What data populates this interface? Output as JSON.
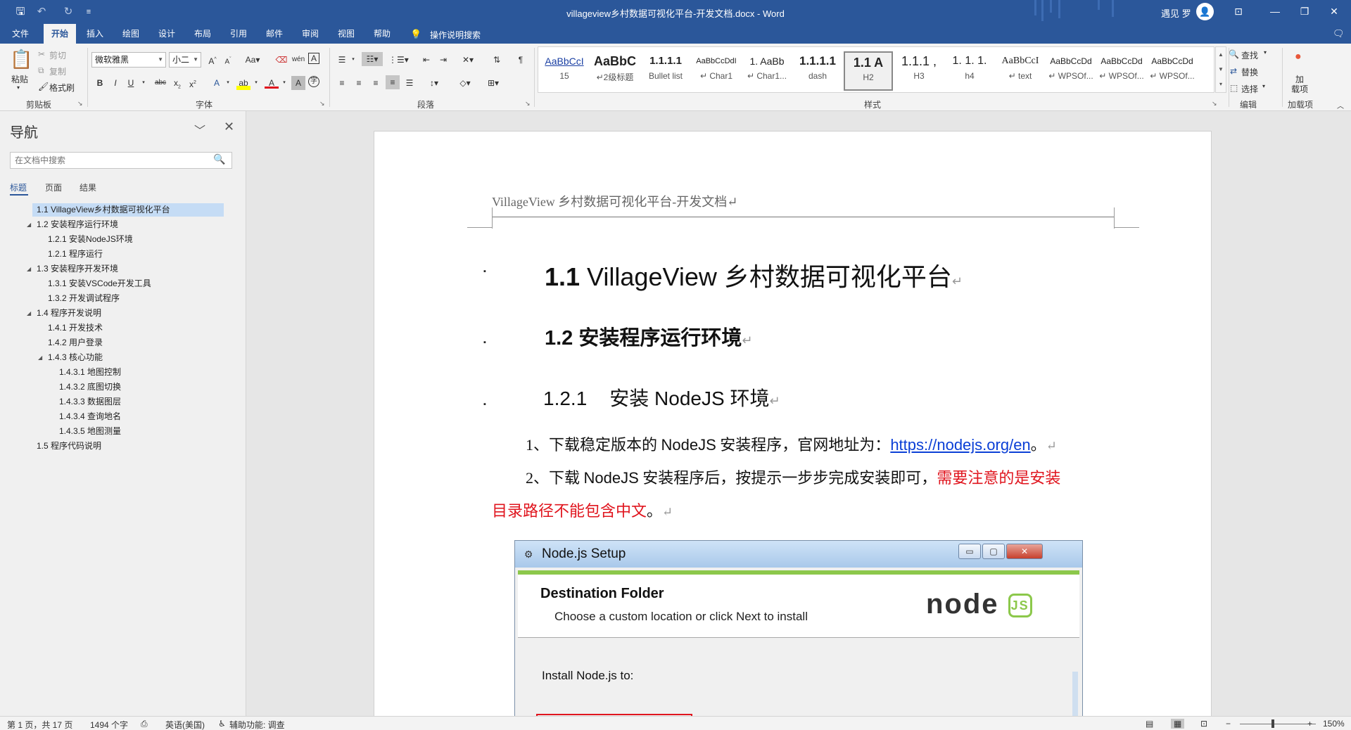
{
  "window": {
    "title": "villageview乡村数据可视化平台-开发文档.docx  -  Word",
    "user_name": "遇见 罗",
    "user_avatar_icon": "person-icon",
    "minimize_glyph": "—",
    "restore_glyph": "❐",
    "close_glyph": "✕",
    "ribbon_display_glyph": "⊡"
  },
  "qat": {
    "save_icon": "save-icon",
    "undo_icon": "undo-icon",
    "redo_icon": "redo-icon",
    "customize_icon": "customize-qat-icon"
  },
  "tabs": [
    "文件",
    "开始",
    "插入",
    "绘图",
    "设计",
    "布局",
    "引用",
    "邮件",
    "审阅",
    "视图",
    "帮助"
  ],
  "active_tab": "开始",
  "tell_me": "操作说明搜索",
  "ribbon": {
    "clipboard": {
      "paste": "粘贴",
      "cut": "剪切",
      "copy": "复制",
      "format_painter": "格式刷",
      "label": "剪贴板"
    },
    "font": {
      "font_name": "微软雅黑",
      "font_size": "小二",
      "label": "字体"
    },
    "paragraph": {
      "label": "段落"
    },
    "styles": {
      "label": "样式",
      "items": [
        {
          "preview": "AaBbCcI",
          "name": "15"
        },
        {
          "preview": "AaBbC",
          "name": "↵2级标题"
        },
        {
          "preview": "1.1.1.1",
          "name": "Bullet list"
        },
        {
          "preview": "AaBbCcDdI",
          "name": "↵ Char1"
        },
        {
          "preview": "1.  AaBb",
          "name": "↵ Char1..."
        },
        {
          "preview": "1.1.1.1",
          "name": "dash"
        },
        {
          "preview": "1.1  A",
          "name": "H2"
        },
        {
          "preview": "1.1.1 ,",
          "name": "H3"
        },
        {
          "preview": "1. 1. 1.",
          "name": "h4"
        },
        {
          "preview": "AaBbCcI",
          "name": "↵ text"
        },
        {
          "preview": "AaBbCcDd",
          "name": "↵ WPSOf..."
        },
        {
          "preview": "AaBbCcDd",
          "name": "↵ WPSOf..."
        },
        {
          "preview": "AaBbCcDd",
          "name": "↵ WPSOf..."
        }
      ],
      "selected": "H2"
    },
    "editing": {
      "find": "查找",
      "replace": "替换",
      "select": "选择",
      "label": "编辑"
    },
    "addins": {
      "button": "加\n载项",
      "label": "加载项"
    }
  },
  "nav": {
    "title": "导航",
    "search_placeholder": "在文档中搜索",
    "tabs": [
      "标题",
      "页面",
      "结果"
    ],
    "active_tab": "标题",
    "headings": [
      {
        "text": "1.1 VillageView乡村数据可视化平台",
        "level": 1,
        "expander": "",
        "selected": true
      },
      {
        "text": "1.2 安装程序运行环境",
        "level": 1,
        "expander": "◢",
        "selected": false
      },
      {
        "text": "1.2.1 安装NodeJS环境",
        "level": 2,
        "expander": "",
        "selected": false
      },
      {
        "text": "1.2.1 程序运行",
        "level": 2,
        "expander": "",
        "selected": false
      },
      {
        "text": "1.3 安装程序开发环境",
        "level": 1,
        "expander": "◢",
        "selected": false
      },
      {
        "text": "1.3.1 安装VSCode开发工具",
        "level": 2,
        "expander": "",
        "selected": false
      },
      {
        "text": "1.3.2 开发调试程序",
        "level": 2,
        "expander": "",
        "selected": false
      },
      {
        "text": "1.4 程序开发说明",
        "level": 1,
        "expander": "◢",
        "selected": false
      },
      {
        "text": "1.4.1 开发技术",
        "level": 2,
        "expander": "",
        "selected": false
      },
      {
        "text": "1.4.2 用户登录",
        "level": 2,
        "expander": "",
        "selected": false
      },
      {
        "text": "1.4.3 核心功能",
        "level": 2,
        "expander": "◢",
        "selected": false
      },
      {
        "text": "1.4.3.1 地图控制",
        "level": 3,
        "expander": "",
        "selected": false
      },
      {
        "text": "1.4.3.2 底图切换",
        "level": 3,
        "expander": "",
        "selected": false
      },
      {
        "text": "1.4.3.3 数据图层",
        "level": 3,
        "expander": "",
        "selected": false
      },
      {
        "text": "1.4.3.4 查询地名",
        "level": 3,
        "expander": "",
        "selected": false
      },
      {
        "text": "1.4.3.5 地图测量",
        "level": 3,
        "expander": "",
        "selected": false
      },
      {
        "text": "1.5 程序代码说明",
        "level": 1,
        "expander": "",
        "selected": false
      }
    ]
  },
  "document": {
    "header": "VillageView 乡村数据可视化平台-开发文档↵",
    "bullet": "▪",
    "h1_num": "1.1",
    "h1_text": " VillageView 乡村数据可视化平台",
    "h2": "1.2 安装程序运行环境",
    "h3_num": "1.2.1",
    "h3_text": "安装 NodeJS 环境",
    "para_mark": "↵",
    "p1_prefix": "1、下载稳定版本的 ",
    "p1_latin": "NodeJS",
    "p1_mid": " 安装程序，官网地址为：",
    "p1_link": "https://nodejs.org/en",
    "p1_end": "。",
    "p2_prefix": "2、下载 ",
    "p2_latin": "NodeJS",
    "p2_mid": " 安装程序后，按提示一步步完成安装即可，",
    "p2_red1": "需要注意的是安装",
    "p2_red2": "目录路径不能包含中文",
    "p2_end": "。"
  },
  "setup_window": {
    "title": "Node.js Setup",
    "min_glyph": "▭",
    "max_glyph": "▢",
    "close_glyph": "✕",
    "heading": "Destination Folder",
    "subheading": "Choose a custom location or click Next to install",
    "logo": "node",
    "logo_js": "JS",
    "install_label": "Install Node.js to:"
  },
  "status": {
    "page": "第 1 页，共 17 页",
    "words": "1494 个字",
    "language": "英语(美国)",
    "accessibility": "辅助功能: 调查",
    "zoom": "150%"
  }
}
